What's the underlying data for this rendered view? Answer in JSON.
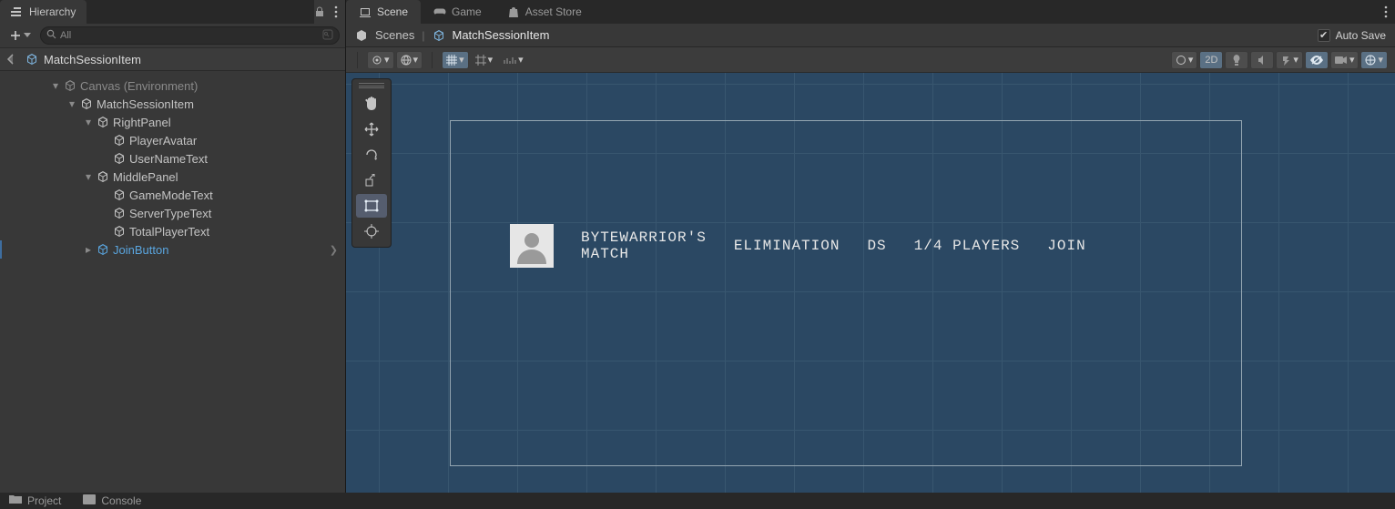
{
  "hierarchy": {
    "tab_label": "Hierarchy",
    "search": {
      "placeholder": "All"
    },
    "path_item": "MatchSessionItem",
    "tree": {
      "canvas": "Canvas (Environment)",
      "match_session_item": "MatchSessionItem",
      "right_panel": "RightPanel",
      "player_avatar": "PlayerAvatar",
      "user_name_text": "UserNameText",
      "middle_panel": "MiddlePanel",
      "game_mode_text": "GameModeText",
      "server_type_text": "ServerTypeText",
      "total_player_text": "TotalPlayerText",
      "join_button": "JoinButton"
    }
  },
  "scene": {
    "tabs": {
      "scene": "Scene",
      "game": "Game",
      "asset_store": "Asset Store"
    },
    "breadcrumb": {
      "root": "Scenes",
      "current": "MatchSessionItem"
    },
    "autosave_label": "Auto Save",
    "toolbar": {
      "mode_2d": "2D"
    },
    "canvas_texts": {
      "username": "BYTEWARRIOR'S\nMATCH",
      "gamemode": "ELIMINATION",
      "servertype": "DS",
      "players": "1/4 PLAYERS",
      "join": "JOIN"
    }
  },
  "bottom_tabs": {
    "project": "Project",
    "console": "Console"
  }
}
